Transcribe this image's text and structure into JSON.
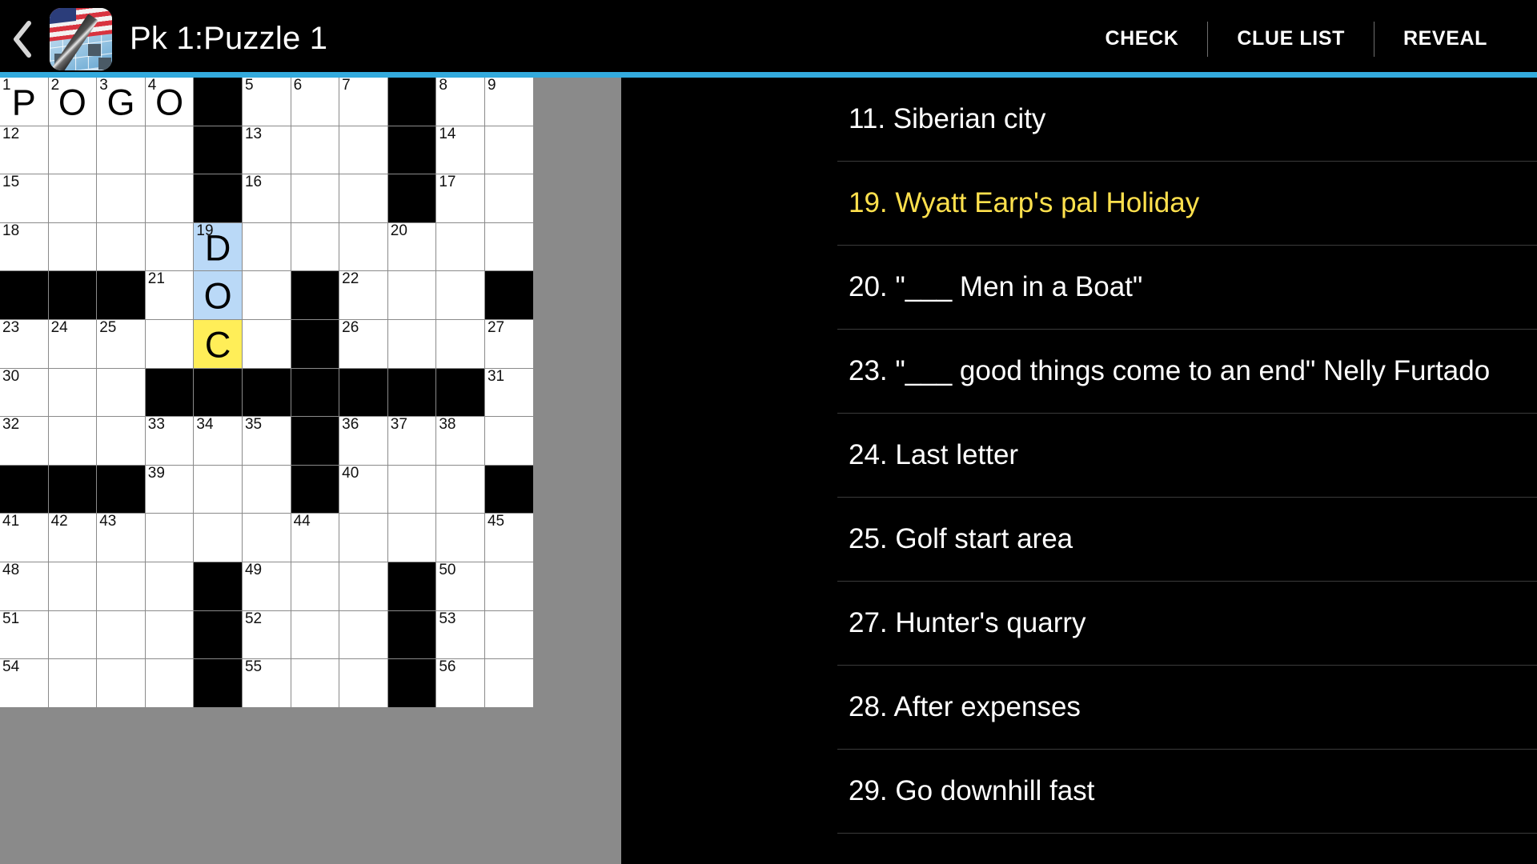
{
  "header": {
    "back_icon": "chevron-left-icon",
    "app_icon": "crossword-app-icon",
    "title": "Pk 1:Puzzle 1",
    "actions": [
      {
        "label": "CHECK"
      },
      {
        "label": "CLUE LIST"
      },
      {
        "label": "REVEAL"
      }
    ]
  },
  "theme": {
    "accent": "#33aadd",
    "background": "#000000",
    "cell_fill": "#ffffff",
    "cell_block": "#000000",
    "word_highlight": "#bad9f7",
    "cursor_highlight": "#ffee58",
    "clue_active": "#ffe14d",
    "clue_text": "#ffffff"
  },
  "grid": {
    "columns": 11,
    "rows": 13,
    "cells": [
      [
        {
          "num": "1",
          "letter": "P"
        },
        {
          "num": "2",
          "letter": "O"
        },
        {
          "num": "3",
          "letter": "G"
        },
        {
          "num": "4",
          "letter": "O"
        },
        {
          "block": true
        },
        {
          "num": "5"
        },
        {
          "num": "6"
        },
        {
          "num": "7"
        },
        {
          "block": true
        },
        {
          "num": "8"
        },
        {
          "num": "9"
        }
      ],
      [
        {
          "num": "12"
        },
        {},
        {},
        {},
        {
          "block": true
        },
        {
          "num": "13"
        },
        {},
        {},
        {
          "block": true
        },
        {
          "num": "14"
        },
        {}
      ],
      [
        {
          "num": "15"
        },
        {},
        {},
        {},
        {
          "block": true
        },
        {
          "num": "16"
        },
        {},
        {},
        {
          "block": true
        },
        {
          "num": "17"
        },
        {}
      ],
      [
        {
          "num": "18"
        },
        {},
        {},
        {},
        {
          "num": "19",
          "letter": "D",
          "state": "highlight"
        },
        {},
        {},
        {},
        {
          "num": "20"
        },
        {},
        {}
      ],
      [
        {
          "block": true
        },
        {
          "block": true
        },
        {
          "block": true
        },
        {
          "num": "21"
        },
        {
          "letter": "O",
          "state": "highlight"
        },
        {},
        {
          "block": true
        },
        {
          "num": "22"
        },
        {},
        {},
        {
          "block": true
        }
      ],
      [
        {
          "num": "23"
        },
        {
          "num": "24"
        },
        {
          "num": "25"
        },
        {},
        {
          "letter": "C",
          "state": "cursor"
        },
        {},
        {
          "block": true
        },
        {
          "num": "26"
        },
        {},
        {},
        {
          "num": "27"
        }
      ],
      [
        {
          "num": "30"
        },
        {},
        {},
        {
          "block": true
        },
        {
          "block": true
        },
        {
          "block": true
        },
        {
          "block": true
        },
        {
          "block": true
        },
        {
          "block": true
        },
        {
          "block": true
        },
        {
          "num": "31"
        }
      ],
      [
        {
          "num": "32"
        },
        {},
        {},
        {
          "num": "33"
        },
        {
          "num": "34"
        },
        {
          "num": "35"
        },
        {
          "block": true
        },
        {
          "num": "36"
        },
        {
          "num": "37"
        },
        {
          "num": "38"
        },
        {}
      ],
      [
        {
          "block": true
        },
        {
          "block": true
        },
        {
          "block": true
        },
        {
          "num": "39"
        },
        {},
        {},
        {
          "block": true
        },
        {
          "num": "40"
        },
        {},
        {},
        {
          "block": true
        }
      ],
      [
        {
          "num": "41"
        },
        {
          "num": "42"
        },
        {
          "num": "43"
        },
        {},
        {},
        {},
        {
          "num": "44"
        },
        {},
        {},
        {},
        {
          "num": "45"
        }
      ],
      [
        {
          "num": "48"
        },
        {},
        {},
        {},
        {
          "block": true
        },
        {
          "num": "49"
        },
        {},
        {},
        {
          "block": true
        },
        {
          "num": "50"
        },
        {}
      ],
      [
        {
          "num": "51"
        },
        {},
        {},
        {},
        {
          "block": true
        },
        {
          "num": "52"
        },
        {},
        {},
        {
          "block": true
        },
        {
          "num": "53"
        },
        {}
      ],
      [
        {
          "num": "54"
        },
        {},
        {},
        {},
        {
          "block": true
        },
        {
          "num": "55"
        },
        {},
        {},
        {
          "block": true
        },
        {
          "num": "56"
        },
        {}
      ]
    ]
  },
  "clues": [
    {
      "text": "11. Siberian city",
      "active": false
    },
    {
      "text": "19. Wyatt Earp's pal Holiday",
      "active": true
    },
    {
      "text": "20. \"___ Men in a Boat\"",
      "active": false
    },
    {
      "text": "23. \"___ good things come to an end\" Nelly Furtado",
      "active": false
    },
    {
      "text": "24. Last letter",
      "active": false
    },
    {
      "text": "25. Golf start area",
      "active": false
    },
    {
      "text": "27. Hunter's quarry",
      "active": false
    },
    {
      "text": "28. After expenses",
      "active": false
    },
    {
      "text": "29. Go downhill fast",
      "active": false
    }
  ]
}
